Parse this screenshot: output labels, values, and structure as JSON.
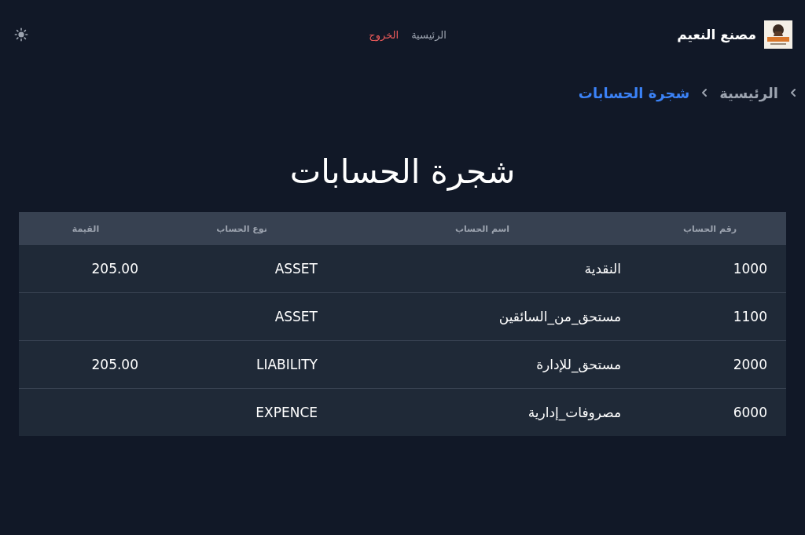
{
  "header": {
    "brand": "مصنع النعيم",
    "nav": [
      {
        "label": "الرئيسية",
        "kind": "link"
      },
      {
        "label": "الخروج",
        "kind": "logout"
      }
    ]
  },
  "breadcrumb": [
    {
      "label": "الرئيسية",
      "selected": false
    },
    {
      "label": "شجرة الحسابات",
      "selected": true
    }
  ],
  "title": "شجرة الحسابات",
  "table": {
    "columns": [
      "رقم الحساب",
      "اسم الحساب",
      "نوع الحساب",
      "القيمة"
    ],
    "rows": [
      [
        "1000",
        "النقدية",
        "ASSET",
        "205.00"
      ],
      [
        "1100",
        "مستحق_من_السائقين",
        "ASSET",
        ""
      ],
      [
        "2000",
        "مستحق_للإدارة",
        "LIABILITY",
        "205.00"
      ],
      [
        "6000",
        "مصروفات_إدارية",
        "EXPENCE",
        ""
      ]
    ]
  }
}
